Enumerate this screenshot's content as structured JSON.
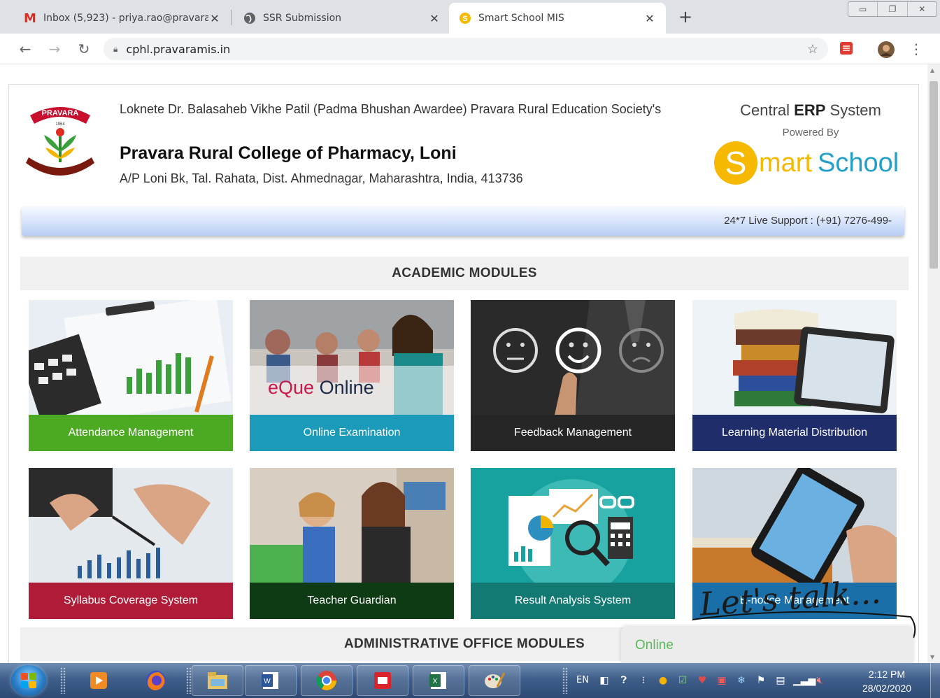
{
  "browser": {
    "tabs": [
      {
        "label": "Inbox (5,923) - priya.rao@pravara",
        "icon": "gmail-icon"
      },
      {
        "label": "SSR Submission",
        "icon": "globe-icon"
      },
      {
        "label": "Smart School MIS",
        "icon": "smart-school-icon"
      }
    ],
    "active_tab": 2,
    "url": "cphl.pravaramis.in"
  },
  "header": {
    "org_line": "Loknete Dr. Balasaheb Vikhe Patil (Padma Bhushan Awardee) Pravara Rural Education Society's",
    "college": "Pravara Rural College of Pharmacy, Loni",
    "address": "A/P Loni Bk, Tal. Rahata, Dist. Ahmednagar, Maharashtra, India, 413736",
    "logo_text": "PRAVARA",
    "logo_year": "1964",
    "erp_pre": "Central ",
    "erp_bold": "ERP",
    "erp_post": " System",
    "powered_by": "Powered By",
    "brand_s": "S",
    "brand_mart": "mart",
    "brand_school": "School"
  },
  "support": {
    "text": "24*7 Live Support : (+91) 7276-499-"
  },
  "academic": {
    "heading": "ACADEMIC MODULES",
    "modules": [
      {
        "label": "Attendance Management",
        "color": "#4caa22"
      },
      {
        "label": "Online Examination",
        "color": "#1b9ab9",
        "overlay_1": "eQue",
        "overlay_2": "Online"
      },
      {
        "label": "Feedback Management",
        "color": "#262626"
      },
      {
        "label": "Learning Material Distribution",
        "color": "#1f2d6b"
      },
      {
        "label": "Syllabus Coverage System",
        "color": "#b01c38"
      },
      {
        "label": "Teacher Guardian",
        "color": "#0e3a14"
      },
      {
        "label": "Result Analysis System",
        "color": "#137a73"
      },
      {
        "label": "E-notice Management",
        "color": "#1a6fa8"
      }
    ]
  },
  "admin": {
    "heading": "ADMINISTRATIVE OFFICE MODULES"
  },
  "chat": {
    "status": "Online",
    "prompt": "Let's talk..."
  },
  "taskbar": {
    "lang": "EN",
    "time": "2:12 PM",
    "date": "28/02/2020"
  }
}
